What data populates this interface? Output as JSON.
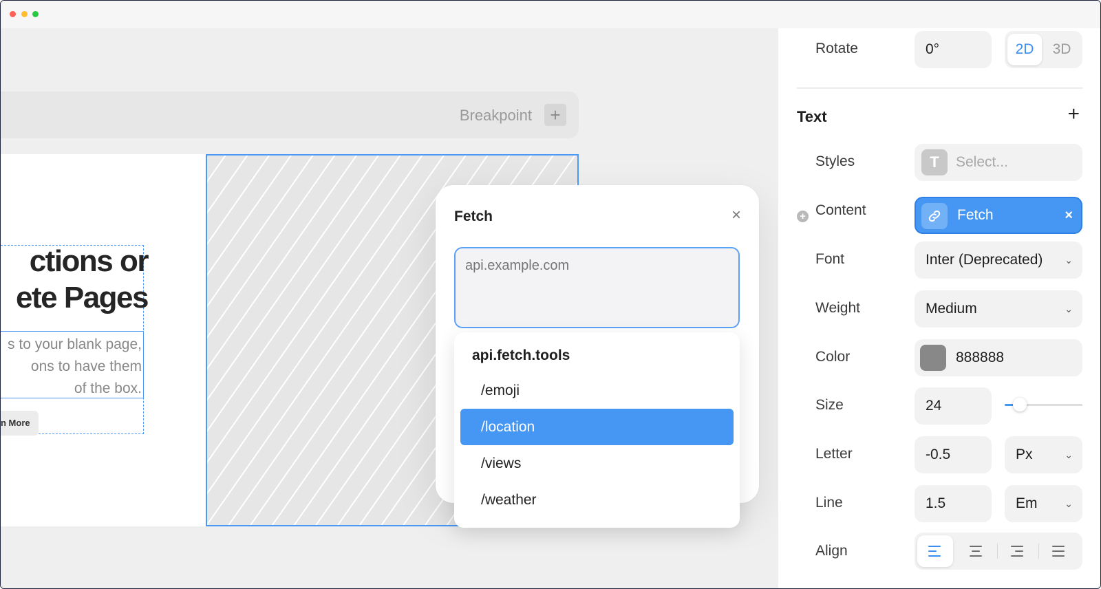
{
  "canvas": {
    "breakpoint_label": "Breakpoint",
    "breakpoint_add": "+",
    "hero": {
      "heading_line1": "ctions or",
      "heading_line2": "ete Pages",
      "sub_line1": "s to your blank page,",
      "sub_line2": "ons to have them",
      "sub_line3": "of the box.",
      "button": "n More"
    }
  },
  "dialog": {
    "title": "Fetch",
    "close": "×",
    "url_placeholder": "api.example.com",
    "dropdown": {
      "header": "api.fetch.tools",
      "items": [
        "/emoji",
        "/location",
        "/views",
        "/weather"
      ],
      "selected": "/location"
    }
  },
  "panel": {
    "rotate": {
      "label": "Rotate",
      "value": "0°",
      "mode_2d": "2D",
      "mode_3d": "3D",
      "active_mode": "2D"
    },
    "text_section": {
      "title": "Text",
      "add": "+"
    },
    "styles": {
      "label": "Styles",
      "icon_letter": "T",
      "placeholder": "Select..."
    },
    "content": {
      "label": "Content",
      "add_icon": "+",
      "value": "Fetch",
      "clear": "×"
    },
    "font": {
      "label": "Font",
      "value": "Inter (Deprecated)"
    },
    "weight": {
      "label": "Weight",
      "value": "Medium"
    },
    "color": {
      "label": "Color",
      "value": "888888",
      "swatch": "#888888"
    },
    "size": {
      "label": "Size",
      "value": "24",
      "slider_fraction": 0.22
    },
    "letter": {
      "label": "Letter",
      "value": "-0.5",
      "unit": "Px"
    },
    "line": {
      "label": "Line",
      "value": "1.5",
      "unit": "Em"
    },
    "align": {
      "label": "Align",
      "options": [
        "left",
        "center",
        "right",
        "justify"
      ],
      "selected": "left"
    }
  },
  "colors": {
    "accent": "#4597f3",
    "selection_border": "#4b98f5"
  }
}
